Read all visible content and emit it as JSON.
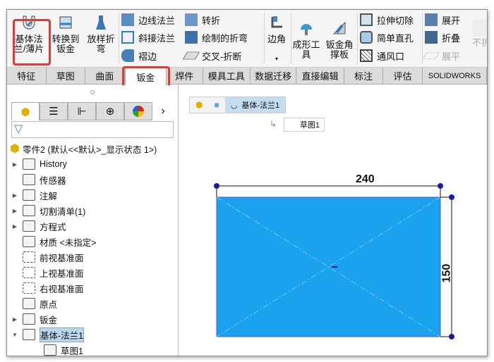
{
  "ribbon": {
    "base_flange": "基体法兰/薄片",
    "convert": "转换到钣金",
    "lofted": "放样折弯",
    "small1": [
      "边线法兰",
      "斜接法兰",
      "褶边"
    ],
    "small2": [
      "转折",
      "绘制的折弯",
      "交叉-折断"
    ],
    "corner": "边角",
    "forming": "成形工具",
    "gusset": "钣金角撑板",
    "small3": [
      "拉伸切除",
      "简单直孔",
      "通风口"
    ],
    "small4": [
      "展开",
      "折叠",
      "展平"
    ],
    "unfold_disabled": "不折"
  },
  "tabs": [
    "特征",
    "草图",
    "曲面",
    "钣金",
    "焊件",
    "模具工具",
    "数据迁移",
    "直接编辑",
    "标注",
    "评估",
    "SOLIDWORKS"
  ],
  "active_tab": "钣金",
  "tree": {
    "root": "零件2  (默认<<默认>_显示状态 1>)",
    "items": [
      "History",
      "传感器",
      "注解",
      "切割清单(1)",
      "方程式",
      "材质 <未指定>",
      "前视基准面",
      "上视基准面",
      "右视基准面",
      "原点",
      "钣金",
      "基体-法兰1",
      "草图1"
    ]
  },
  "breadcrumb": {
    "current": "基体-法兰1",
    "sketch": "草图1"
  },
  "sketch": {
    "width_dim": "240",
    "height_dim": "150",
    "fill": "#1ba2ef",
    "highlight": "#e53935"
  }
}
